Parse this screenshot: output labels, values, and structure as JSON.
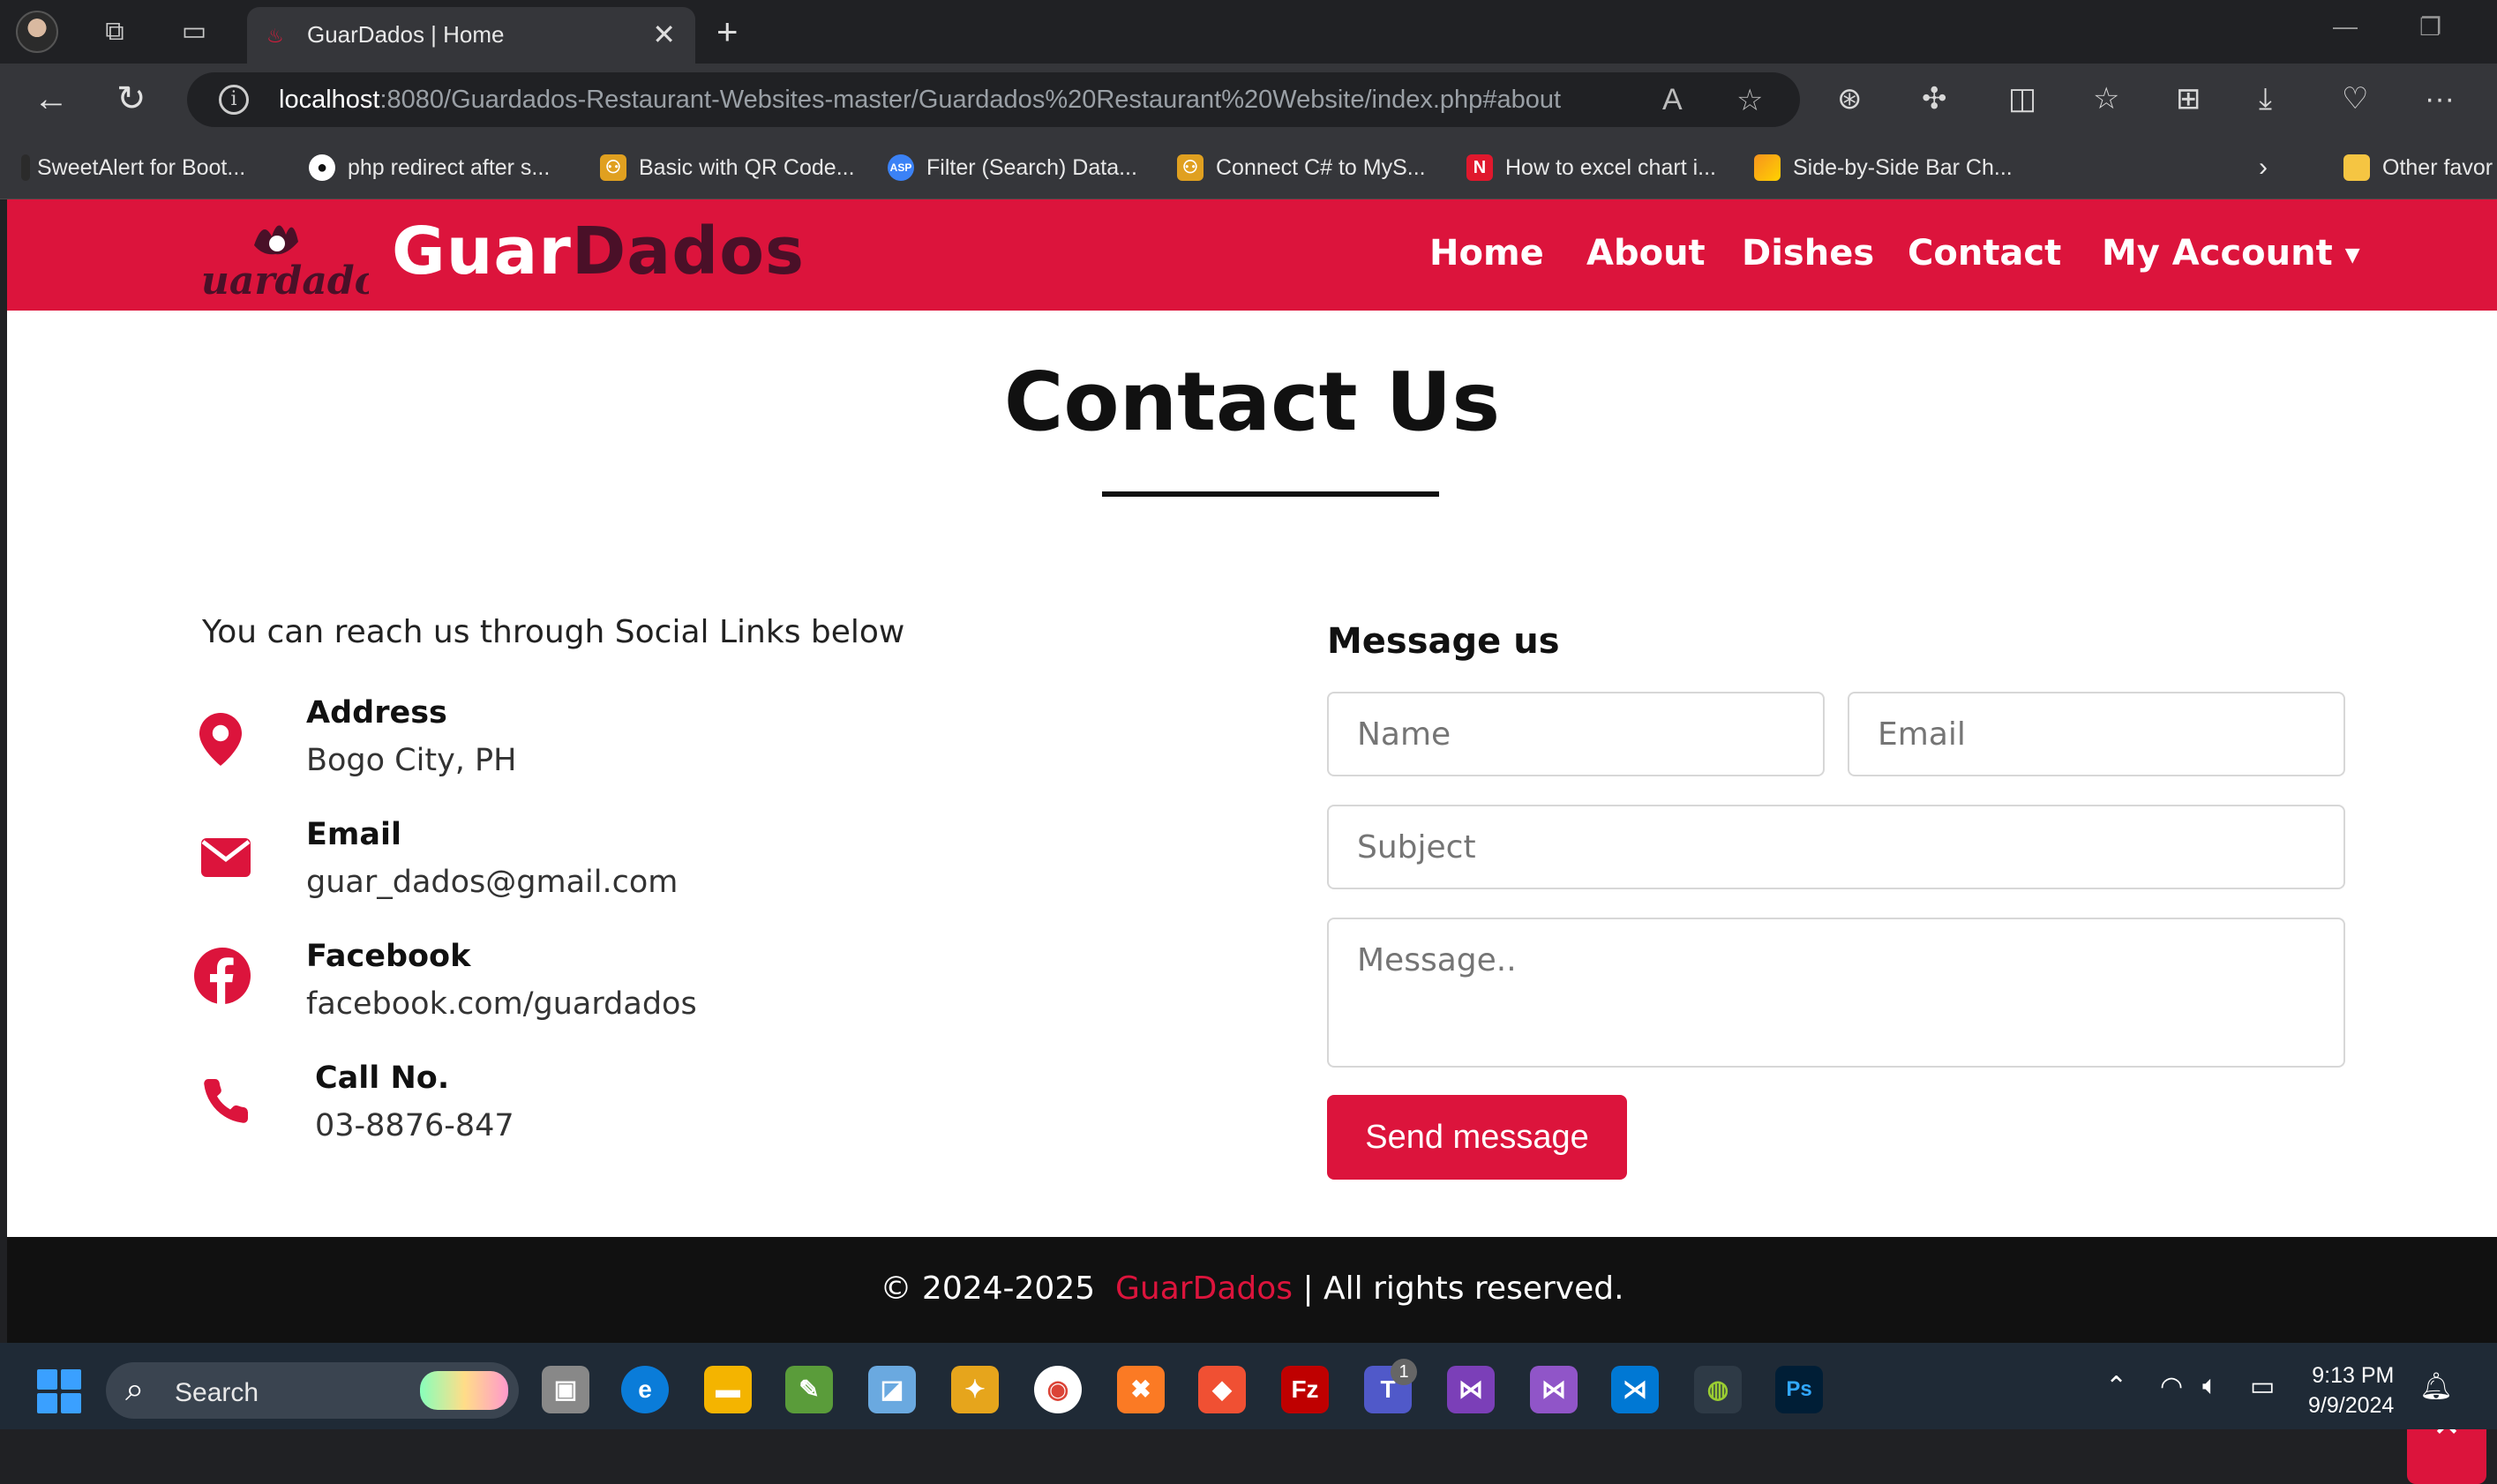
{
  "browser": {
    "tab_title": "GuarDados | Home",
    "url_host": "localhost",
    "url_rest": ":8080/Guardados-Restaurant-Websites-master/Guardados%20Restaurant%20Website/index.php#about",
    "bookmarks": [
      {
        "label": "SweetAlert for Boot...",
        "icon": "sweetalert-icon"
      },
      {
        "label": "php redirect after s...",
        "icon": "github-icon"
      },
      {
        "label": "Basic with QR Code...",
        "icon": "qr-icon"
      },
      {
        "label": "Filter (Search) Data...",
        "icon": "asp-icon"
      },
      {
        "label": "Connect C# to MyS...",
        "icon": "codeproject-icon"
      },
      {
        "label": "How to excel chart i...",
        "icon": "excel-chart-icon"
      },
      {
        "label": "Side-by-Side Bar Ch...",
        "icon": "chart-icon"
      }
    ],
    "other_favorites": "Other favor"
  },
  "site": {
    "logo_script": "Guardados",
    "brand_part1": "Guar",
    "brand_part2": "Dados",
    "nav": [
      "Home",
      "About",
      "Dishes",
      "Contact",
      "My Account"
    ],
    "colors": {
      "accent": "#dc143c",
      "brand_dark": "#4a1028"
    }
  },
  "contact": {
    "title": "Contact Us",
    "intro": "You can reach us through Social Links below",
    "items": [
      {
        "label": "Address",
        "value": "Bogo City, PH",
        "icon": "map-pin-icon"
      },
      {
        "label": "Email",
        "value": "guar_dados@gmail.com",
        "icon": "envelope-icon"
      },
      {
        "label": "Facebook",
        "value": "facebook.com/guardados",
        "icon": "facebook-icon"
      },
      {
        "label": "Call No.",
        "value": "03-8876-847",
        "icon": "phone-icon"
      }
    ]
  },
  "form": {
    "title": "Message us",
    "name_placeholder": "Name",
    "email_placeholder": "Email",
    "subject_placeholder": "Subject",
    "message_placeholder": "Message..",
    "send_label": "Send message"
  },
  "footer": {
    "prefix": "© 2024-2025",
    "brand": "GuarDados",
    "suffix": "| All rights reserved."
  },
  "taskbar": {
    "search_label": "Search",
    "time": "9:13 PM",
    "date": "9/9/2024",
    "teams_badge": "1"
  }
}
